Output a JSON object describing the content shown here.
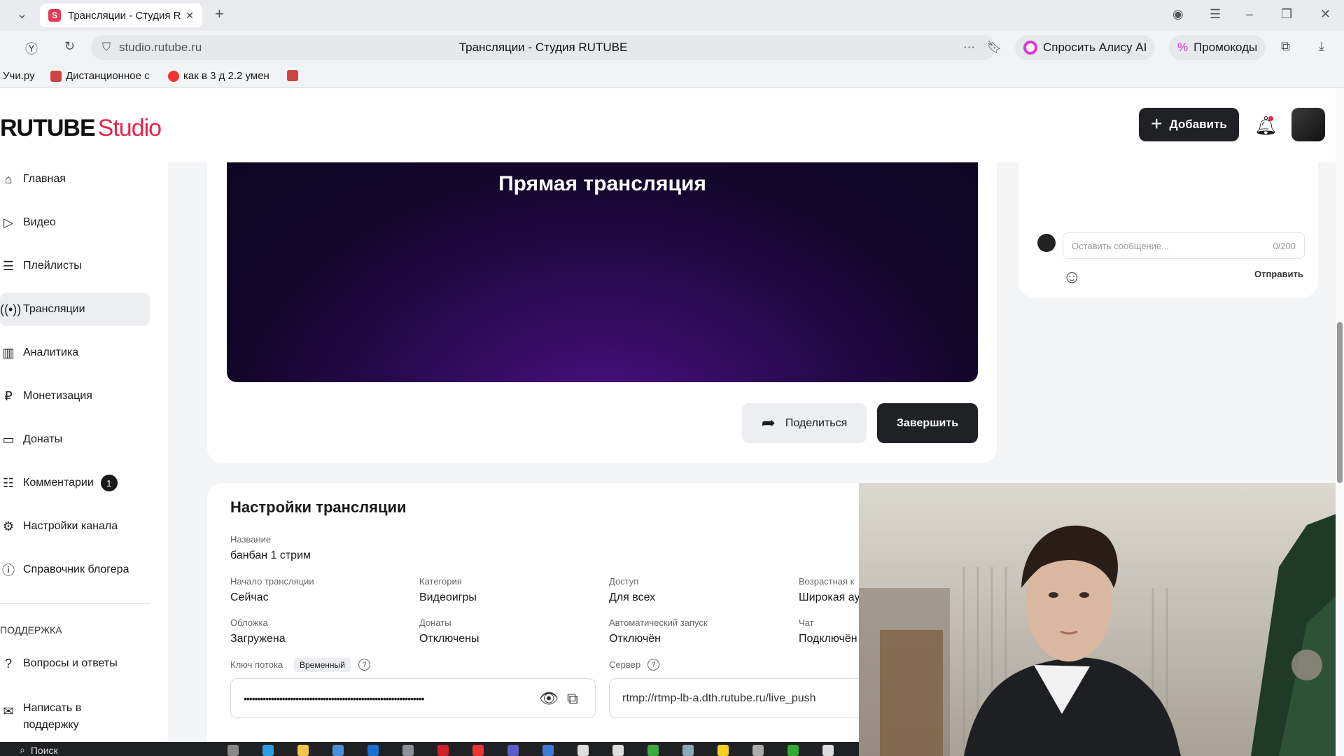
{
  "browser": {
    "tab_title": "Трансляции - Студия R",
    "url": "studio.rutube.ru",
    "page_title": "Трансляции - Студия RUTUBE",
    "alice_button": "Спросить Алису AI",
    "promo_button": "Промокоды",
    "bookmarks": [
      "Учи.ру",
      "Дистанционное с",
      "как в 3 д 2.2 умен"
    ]
  },
  "studio": {
    "logo_main": "RUTUBE",
    "logo_sub": "Studio",
    "add_button": "Добавить"
  },
  "sidebar": {
    "items": [
      {
        "label": "Главная",
        "icon": "home-icon"
      },
      {
        "label": "Видео",
        "icon": "video-icon"
      },
      {
        "label": "Плейлисты",
        "icon": "playlist-icon"
      },
      {
        "label": "Трансляции",
        "icon": "broadcast-icon",
        "active": true
      },
      {
        "label": "Аналитика",
        "icon": "analytics-icon"
      },
      {
        "label": "Монетизация",
        "icon": "ruble-icon"
      },
      {
        "label": "Донаты",
        "icon": "wallet-icon"
      },
      {
        "label": "Комментарии",
        "icon": "comment-icon",
        "badge": "1"
      },
      {
        "label": "Настройки канала",
        "icon": "gear-icon"
      },
      {
        "label": "Справочник блогера",
        "icon": "info-icon"
      }
    ],
    "support_section": "Поддержка",
    "support_items": [
      {
        "label": "Вопросы и ответы",
        "icon": "question-icon"
      },
      {
        "label": "Написать в поддержку",
        "icon": "mail-icon"
      }
    ]
  },
  "player": {
    "title": "Прямая трансляция"
  },
  "actions": {
    "share": "Поделиться",
    "end": "Завершить"
  },
  "chat": {
    "placeholder": "Оставить сообщение...",
    "counter": "0/200",
    "send": "Отправить"
  },
  "settings": {
    "title": "Настройки трансляции",
    "name_label": "Название",
    "name_value": "банбан 1 стрим",
    "start_label": "Начало трансляции",
    "start_value": "Сейчас",
    "category_label": "Категория",
    "category_value": "Видеоигры",
    "access_label": "Доступ",
    "access_value": "Для всех",
    "age_label": "Возрастная к",
    "age_value": "Широкая ау",
    "cover_label": "Обложка",
    "cover_value": "Загружена",
    "donations_label": "Донаты",
    "donations_value": "Отключены",
    "autostart_label": "Автоматический запуск",
    "autostart_value": "Отключён",
    "chat_label": "Чат",
    "chat_value": "Подключён",
    "key_label": "Ключ потока",
    "key_tag": "Временный",
    "key_value": "••••••••••••••••••••••••••••••••••••••••••••••••••••••••••••••••••",
    "server_label": "Сервер",
    "server_value": "rtmp://rtmp-lb-a.dth.rutube.ru/live_push"
  },
  "taskbar": {
    "search": "Поиск"
  },
  "colors": {
    "brand": "#e3254b",
    "dark_button": "#1f2125"
  }
}
